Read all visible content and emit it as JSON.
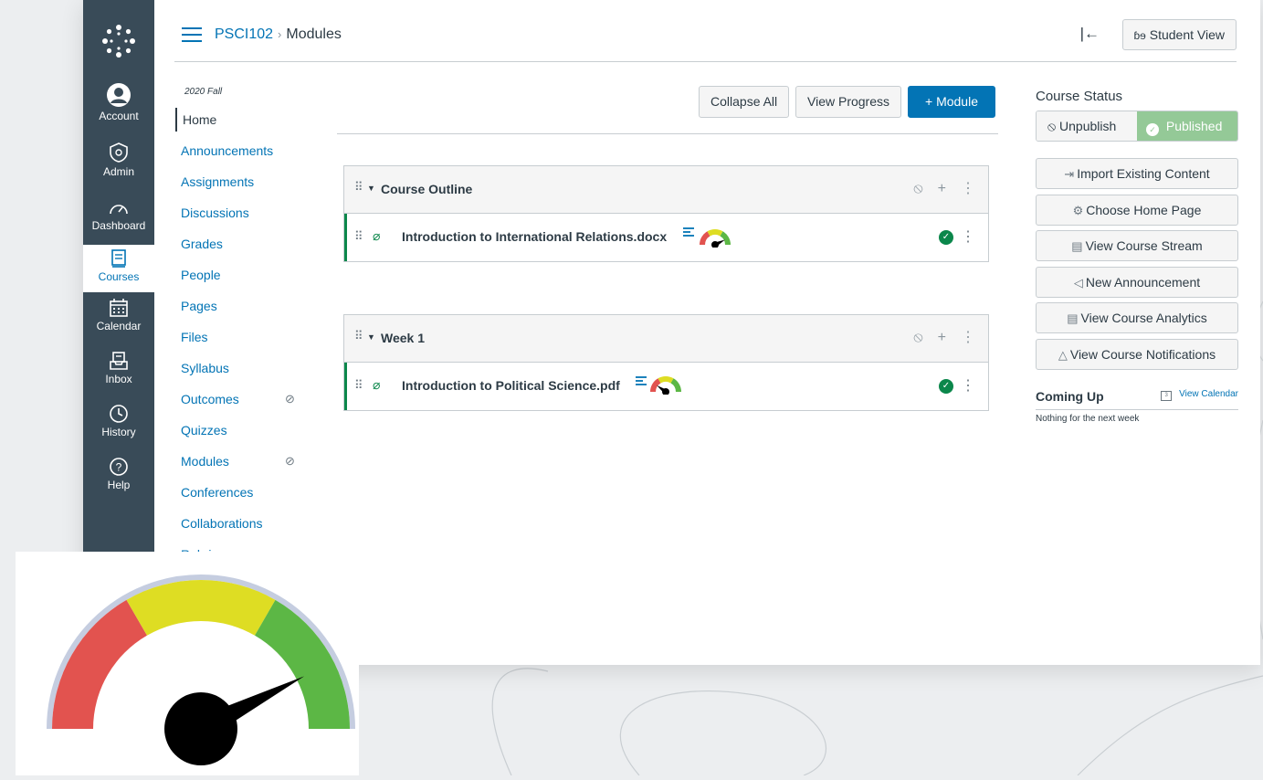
{
  "header": {
    "breadcrumb_course": "PSCI102",
    "breadcrumb_sep": "›",
    "breadcrumb_current": "Modules",
    "collapse_nav_icon": "|←",
    "student_view_label": "Student View"
  },
  "global_nav": {
    "items": [
      {
        "label": "Account"
      },
      {
        "label": "Admin"
      },
      {
        "label": "Dashboard"
      },
      {
        "label": "Courses"
      },
      {
        "label": "Calendar"
      },
      {
        "label": "Inbox"
      },
      {
        "label": "History"
      },
      {
        "label": "Help"
      }
    ]
  },
  "course_nav": {
    "term": "2020 Fall",
    "items": [
      {
        "label": "Home"
      },
      {
        "label": "Announcements"
      },
      {
        "label": "Assignments"
      },
      {
        "label": "Discussions"
      },
      {
        "label": "Grades"
      },
      {
        "label": "People"
      },
      {
        "label": "Pages"
      },
      {
        "label": "Files"
      },
      {
        "label": "Syllabus"
      },
      {
        "label": "Outcomes"
      },
      {
        "label": "Quizzes"
      },
      {
        "label": "Modules"
      },
      {
        "label": "Conferences"
      },
      {
        "label": "Collaborations"
      },
      {
        "label": "Rubrics"
      }
    ]
  },
  "toolbar": {
    "collapse_all": "Collapse All",
    "view_progress": "View Progress",
    "add_module": "+ Module"
  },
  "modules": [
    {
      "title": "Course Outline",
      "items": [
        {
          "title": "Introduction to International Relations.docx",
          "gauge_level": 0.85
        }
      ]
    },
    {
      "title": "Week 1",
      "items": [
        {
          "title": "Introduction to Political Science.pdf",
          "gauge_level": 0.2
        }
      ]
    }
  ],
  "sidebar": {
    "course_status": "Course Status",
    "unpublish": "Unpublish",
    "published": "Published",
    "buttons": [
      {
        "label": "Import Existing Content"
      },
      {
        "label": "Choose Home Page"
      },
      {
        "label": "View Course Stream"
      },
      {
        "label": "New Announcement"
      },
      {
        "label": "View Course Analytics"
      },
      {
        "label": "View Course Notifications"
      }
    ],
    "coming_up": "Coming Up",
    "view_calendar": "View Calendar",
    "calendar_icon_text": "3",
    "nothing_next": "Nothing for the next week"
  },
  "big_gauge": {
    "level": 0.85
  },
  "colors": {
    "nav_bg": "#394b58",
    "link": "#0374b5",
    "published_green": "#94c997",
    "success": "#0b874b",
    "gauge_red": "#e2534f",
    "gauge_yellow": "#dedd23",
    "gauge_green": "#5cb745"
  }
}
